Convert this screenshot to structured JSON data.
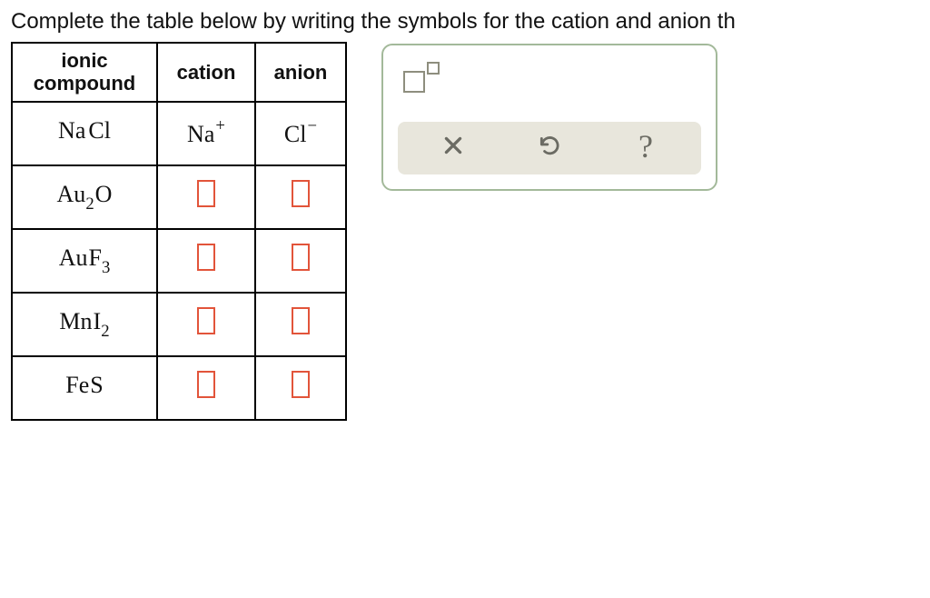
{
  "prompt": "Complete the table below by writing the symbols for the cation and anion th",
  "headers": {
    "compound_line1": "ionic",
    "compound_line2": "compound",
    "cation": "cation",
    "anion": "anion"
  },
  "rows": [
    {
      "compound_main": "Na",
      "compound_sub": "",
      "compound_tail": "Cl",
      "compound_tail_sub": "",
      "cation_base": "Na",
      "cation_sup": "+",
      "anion_base": "Cl",
      "anion_sup": "−",
      "filled": true
    },
    {
      "compound_main": "Au",
      "compound_sub": "2",
      "compound_tail": "O",
      "compound_tail_sub": "",
      "filled": false
    },
    {
      "compound_main": "Au",
      "compound_sub": "",
      "compound_tail": "F",
      "compound_tail_sub": "3",
      "filled": false
    },
    {
      "compound_main": "Mn",
      "compound_sub": "",
      "compound_tail": "I",
      "compound_tail_sub": "2",
      "filled": false
    },
    {
      "compound_main": "Fe",
      "compound_sub": "",
      "compound_tail": "S",
      "compound_tail_sub": "",
      "filled": false
    }
  ],
  "toolbox": {
    "insert_tool": "superscript-box-tool",
    "clear": "clear",
    "reset": "reset",
    "help": "help",
    "help_glyph": "?"
  }
}
